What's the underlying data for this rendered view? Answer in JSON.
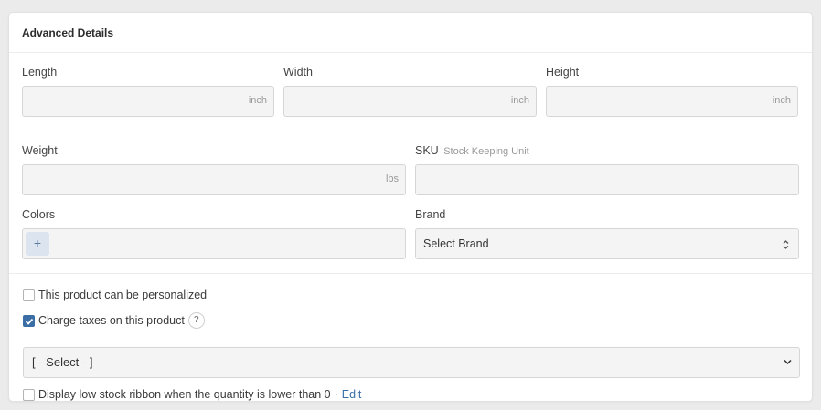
{
  "card": {
    "title": "Advanced Details"
  },
  "dimensions": {
    "length": {
      "label": "Length",
      "value": "",
      "unit": "inch"
    },
    "width": {
      "label": "Width",
      "value": "",
      "unit": "inch"
    },
    "height": {
      "label": "Height",
      "value": "",
      "unit": "inch"
    }
  },
  "weight": {
    "label": "Weight",
    "value": "",
    "unit": "lbs"
  },
  "sku": {
    "label": "SKU",
    "hint": "Stock Keeping Unit",
    "value": ""
  },
  "colors": {
    "label": "Colors",
    "add_symbol": "+"
  },
  "brand": {
    "label": "Brand",
    "selected": "Select Brand"
  },
  "options": {
    "personalized": {
      "label": "This product can be personalized",
      "checked": false
    },
    "taxes": {
      "label": "Charge taxes on this product",
      "checked": true,
      "help": "?"
    },
    "tax_select": {
      "selected": "[ - Select - ]"
    },
    "low_stock": {
      "label": "Display low stock ribbon when the quantity is lower than 0",
      "separator": "·",
      "edit_label": "Edit",
      "checked": false
    }
  },
  "colors_theme": {
    "accent": "#3a6ea5",
    "input_bg": "#f4f4f4",
    "border": "#d6d6d6"
  }
}
